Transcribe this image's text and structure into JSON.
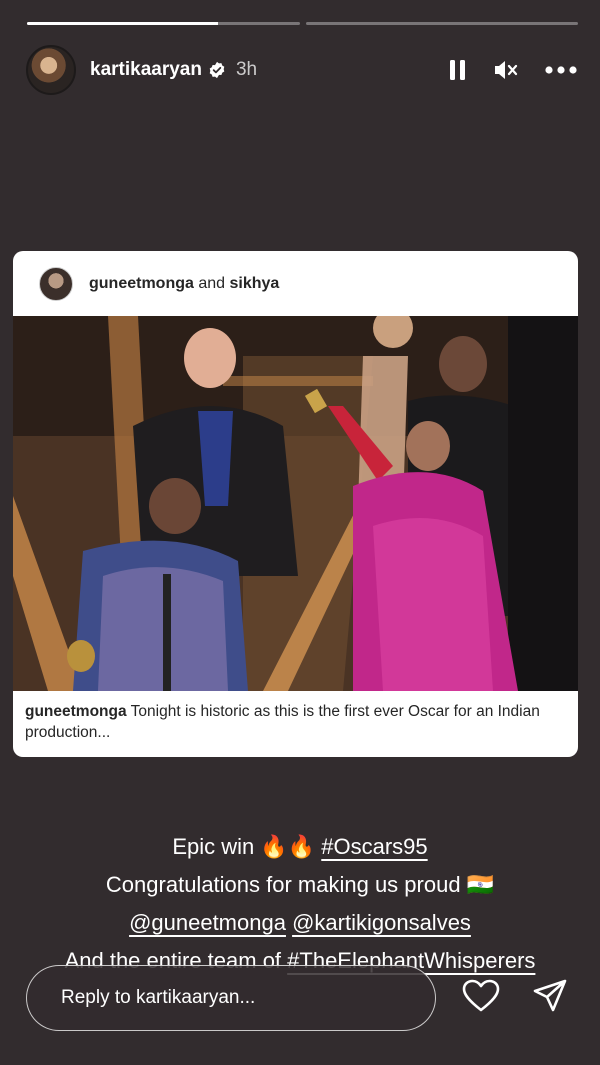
{
  "progress": {
    "segments": [
      {
        "filled": 0.7
      },
      {
        "filled": 0.0
      }
    ]
  },
  "header": {
    "username": "kartikaaryan",
    "time": "3h",
    "icons": [
      "pause-icon",
      "mute-icon",
      "more-icon"
    ]
  },
  "shared_post": {
    "authors_primary": "guneetmonga",
    "authors_connector": " and ",
    "authors_secondary": "sikhya",
    "caption_user": "guneetmonga",
    "caption_text": " Tonight is historic as this is the first ever Oscar for an Indian production..."
  },
  "story_text": {
    "line1_prefix": "Epic win 🔥🔥 ",
    "line1_hashtag": "#Oscars95",
    "line2": "Congratulations for making us proud 🇮🇳",
    "line3_mention1": "@guneetmonga",
    "line3_mention2": "@kartikigonsalves",
    "line4_prefix": "And the entire team of ",
    "line4_hashtag": "#TheElephantWhisperers"
  },
  "reply": {
    "placeholder": "Reply to kartikaaryan..."
  },
  "colors": {
    "background": "#322c2e",
    "card": "#ffffff",
    "text": "#ffffff"
  }
}
